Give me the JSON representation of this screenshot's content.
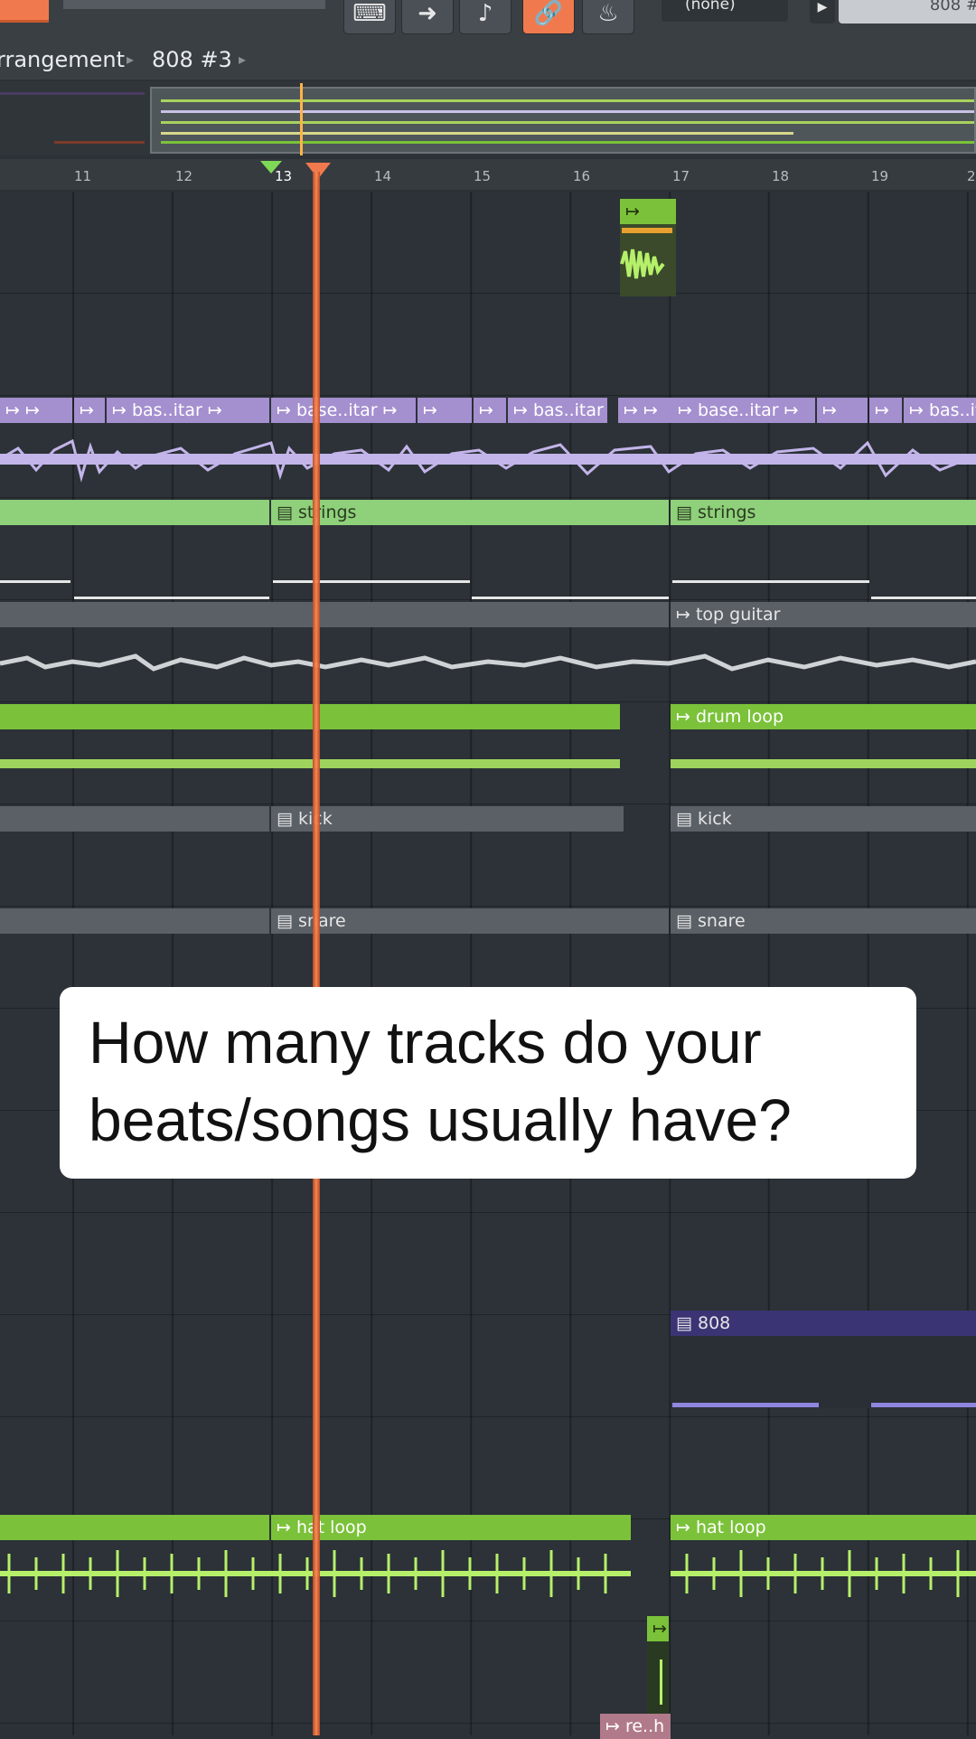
{
  "toolbar": {
    "pattern_select": "(none)",
    "pattern_right": "808 #"
  },
  "breadcrumb": {
    "root": "rrangement",
    "separator": "▸",
    "item": "808 #3"
  },
  "ruler": {
    "bars": [
      "11",
      "12",
      "13",
      "14",
      "15",
      "16",
      "17",
      "18",
      "19",
      "2"
    ]
  },
  "clips": {
    "bass_guitar_short": "bas..itar",
    "bass_guitar_long": "base..itar",
    "strings": "strings",
    "top_guitar": "top guitar",
    "drum_loop": "drum loop",
    "kick": "kick",
    "snare": "snare",
    "b808": "808",
    "hat_loop": "hat loop",
    "perc": "re..h"
  },
  "caption": {
    "line1": "How many tracks do your",
    "line2": "beats/songs usually have?"
  },
  "colors": {
    "accent": "#f07a4e",
    "green_clip": "#7bc23a",
    "lavender_clip": "#a48fcf",
    "purple_clip": "#3a3475"
  }
}
